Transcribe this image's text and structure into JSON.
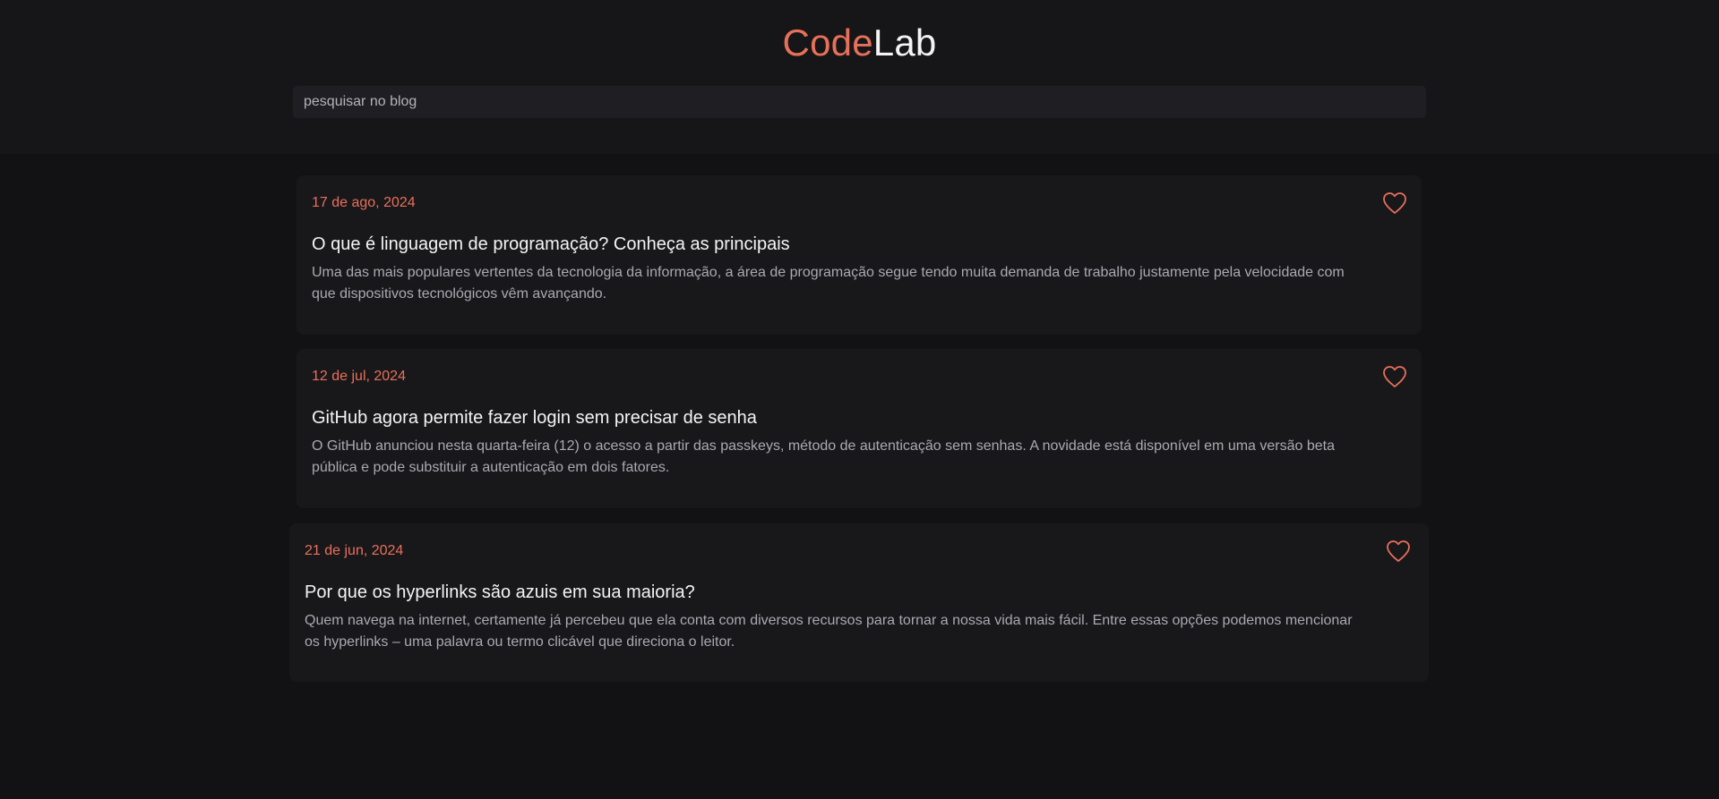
{
  "brand": {
    "part1": "Code",
    "part2": "Lab"
  },
  "search": {
    "placeholder": "pesquisar no blog"
  },
  "posts": [
    {
      "date": "17 de ago, 2024",
      "title": "O que é linguagem de programação? Conheça as principais",
      "excerpt": "Uma das mais populares vertentes da tecnologia da informação, a área de programação segue tendo muita demanda de trabalho justamente pela velocidade com que dispositivos tecnológicos vêm avançando."
    },
    {
      "date": "12 de jul, 2024",
      "title": "GitHub agora permite fazer login sem precisar de senha",
      "excerpt": "O GitHub anunciou nesta quarta-feira (12) o acesso a partir das passkeys, método de autenticação sem senhas. A novidade está disponível em uma versão beta pública e pode substituir a autenticação em dois fatores."
    },
    {
      "date": "21 de jun, 2024",
      "title": "Por que os hyperlinks são azuis em sua maioria?",
      "excerpt": "Quem navega na internet, certamente já percebeu que ela conta com diversos recursos para tornar a nossa vida mais fácil. Entre essas opções podemos mencionar os hyperlinks – uma palavra ou termo clicável que direciona o leitor."
    }
  ],
  "icons": {
    "favorite": "heart-outline-icon"
  },
  "colors": {
    "accent": "#e8705a",
    "background": "#121214",
    "card": "#18181b"
  }
}
